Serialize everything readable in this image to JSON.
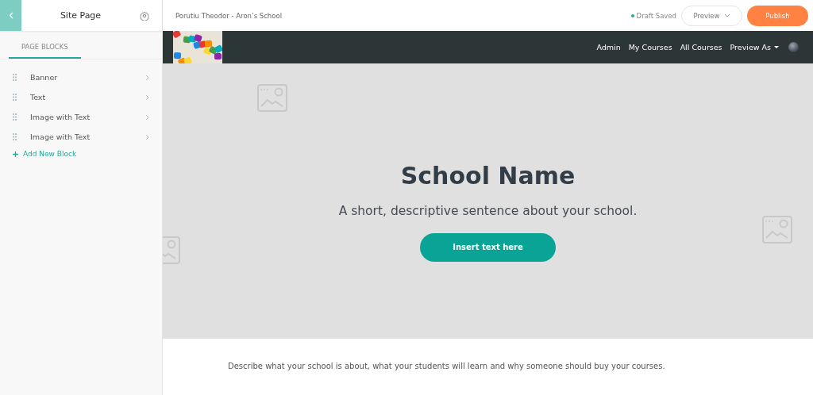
{
  "sidebar": {
    "title": "Site Page",
    "tabs": [
      {
        "label": "PAGE BLOCKS",
        "selected": true
      }
    ],
    "blocks": [
      {
        "label": "Banner"
      },
      {
        "label": "Text"
      },
      {
        "label": "Image with Text"
      },
      {
        "label": "Image with Text"
      }
    ],
    "add_block": "Add New Block"
  },
  "topbar": {
    "school": "Porutiu Theodor - Aron’s School",
    "status": "Draft Saved",
    "preview_button": "Preview",
    "publish_button": "Publish"
  },
  "site_nav": {
    "links": [
      "Admin",
      "My Courses",
      "All Courses"
    ],
    "preview_as": "Preview As"
  },
  "hero": {
    "title": "School Name",
    "subtitle": "A short, descriptive sentence about your school.",
    "button": "Insert text here"
  },
  "description": "Describe what your school is about, what your students will learn and why someone should buy your courses."
}
